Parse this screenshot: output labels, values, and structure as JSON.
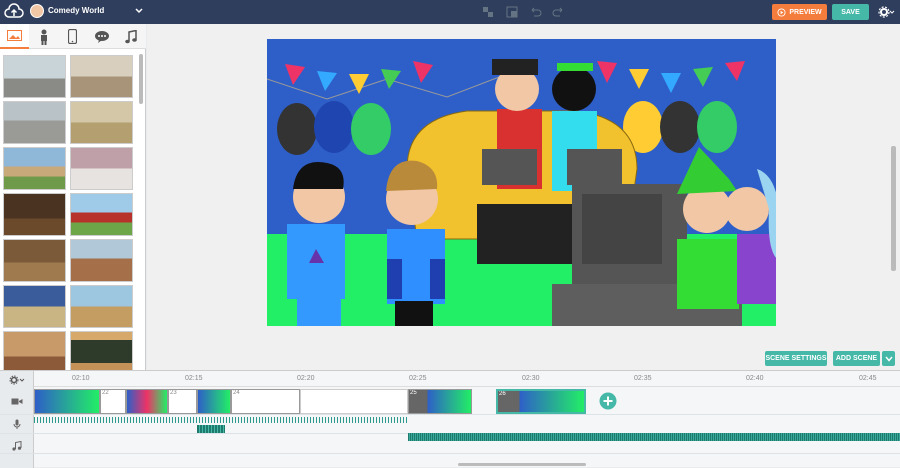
{
  "topbar": {
    "project_title": "Comedy World",
    "preview_label": "PREVIEW",
    "save_label": "SAVE"
  },
  "sidebar": {
    "tabs": [
      "backgrounds",
      "characters",
      "props",
      "speech",
      "audio"
    ]
  },
  "stage": {
    "scene_settings_label": "SCENE SETTINGS",
    "add_scene_label": "ADD SCENE"
  },
  "timeline": {
    "ticks": [
      "02:10",
      "02:15",
      "02:20",
      "02:25",
      "02:30",
      "02:35",
      "02:40",
      "02:45"
    ],
    "scene_numbers": [
      "22",
      "23",
      "24",
      "25",
      "26"
    ]
  },
  "colors": {
    "topbar": "#2f3e5c",
    "preview": "#f47c3c",
    "teal": "#45b8a8"
  }
}
